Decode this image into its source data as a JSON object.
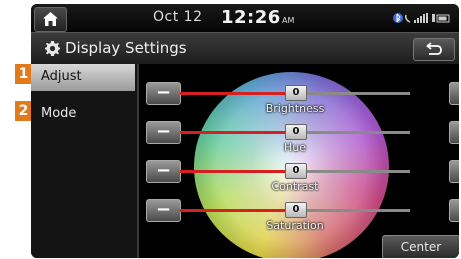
{
  "status": {
    "date": "Oct 12",
    "time": "12:26",
    "ampm": "AM"
  },
  "titlebar": {
    "title": "Display Settings"
  },
  "sidebar": {
    "items": [
      {
        "label": "Adjust",
        "badge": "1"
      },
      {
        "label": "Mode",
        "badge": "2"
      }
    ]
  },
  "sliders": [
    {
      "label": "Brightness",
      "value": "0",
      "level": 0.5
    },
    {
      "label": "Hue",
      "value": "0",
      "level": 0.5
    },
    {
      "label": "Contrast",
      "value": "0",
      "level": 0.5
    },
    {
      "label": "Saturation",
      "value": "0",
      "level": 0.5
    }
  ],
  "controls": {
    "minus": "−",
    "plus": "+",
    "center_label": "Center"
  },
  "colors": {
    "accent": "#e07a1a",
    "slider_fill": "#d62020"
  }
}
